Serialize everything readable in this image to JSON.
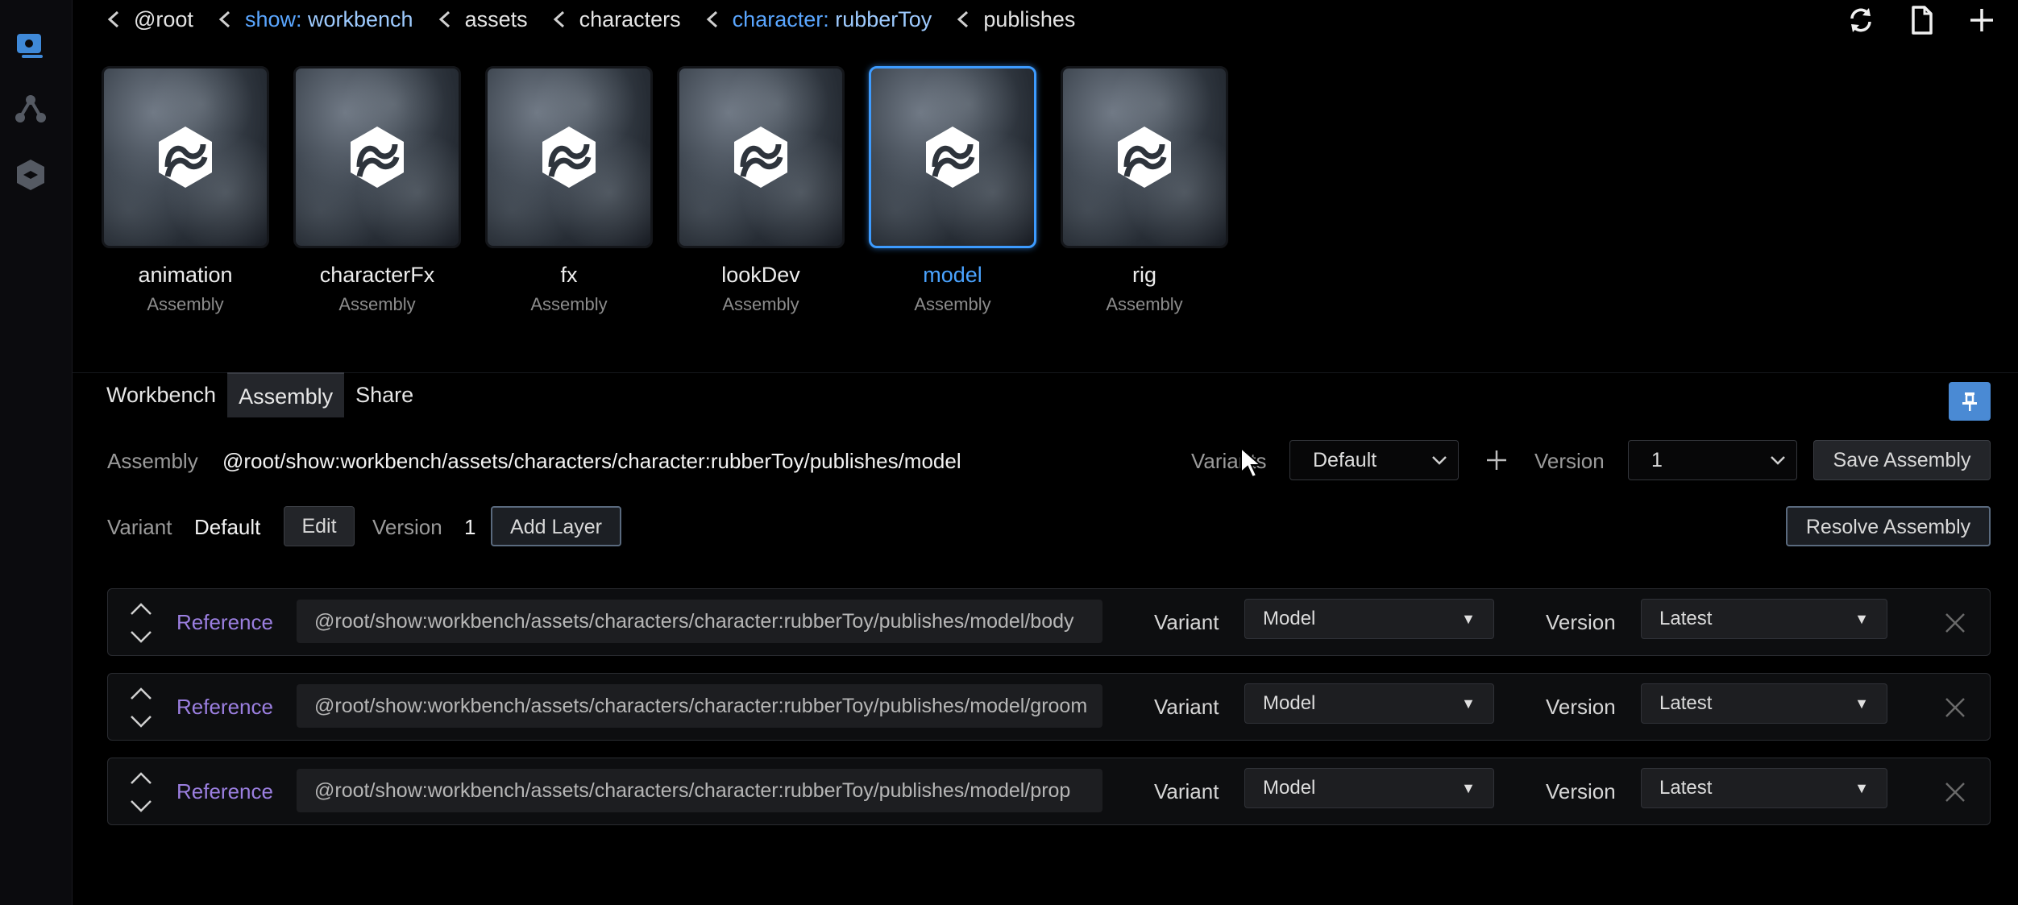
{
  "breadcrumbs": [
    {
      "key": "",
      "value": "@root"
    },
    {
      "key": "show:",
      "value": " workbench"
    },
    {
      "key": "",
      "value": "assets"
    },
    {
      "key": "",
      "value": "characters"
    },
    {
      "key": "character:",
      "value": " rubberToy"
    },
    {
      "key": "",
      "value": "publishes"
    }
  ],
  "top_actions": [
    "refresh-icon",
    "file-icon",
    "plus-icon"
  ],
  "sidebar_icons": [
    "viewer-icon",
    "graph-icon",
    "cube-icon"
  ],
  "cards": [
    {
      "title": "animation",
      "subtitle": "Assembly"
    },
    {
      "title": "characterFx",
      "subtitle": "Assembly"
    },
    {
      "title": "fx",
      "subtitle": "Assembly"
    },
    {
      "title": "lookDev",
      "subtitle": "Assembly"
    },
    {
      "title": "model",
      "subtitle": "Assembly",
      "selected": true
    },
    {
      "title": "rig",
      "subtitle": "Assembly"
    }
  ],
  "tabs": [
    {
      "label": "Workbench"
    },
    {
      "label": "Assembly",
      "active": true
    },
    {
      "label": "Share"
    }
  ],
  "assembly": {
    "label": "Assembly",
    "path": "@root/show:workbench/assets/characters/character:rubberToy/publishes/model",
    "variants_label": "Variants",
    "variants_value": "Default",
    "version_label": "Version",
    "version_value": "1",
    "save_label": "Save Assembly"
  },
  "variant_row": {
    "variant_label": "Variant",
    "variant_value": "Default",
    "edit_label": "Edit",
    "version_label": "Version",
    "version_value": "1",
    "add_layer_label": "Add Layer",
    "resolve_label": "Resolve Assembly"
  },
  "layers": [
    {
      "type": "Reference",
      "path": "@root/show:workbench/assets/characters/character:rubberToy/publishes/model/body",
      "variant_label": "Variant",
      "variant": "Model",
      "version_label": "Version",
      "version": "Latest"
    },
    {
      "type": "Reference",
      "path": "@root/show:workbench/assets/characters/character:rubberToy/publishes/model/groom",
      "variant_label": "Variant",
      "variant": "Model",
      "version_label": "Version",
      "version": "Latest"
    },
    {
      "type": "Reference",
      "path": "@root/show:workbench/assets/characters/character:rubberToy/publishes/model/prop",
      "variant_label": "Variant",
      "variant": "Model",
      "version_label": "Version",
      "version": "Latest"
    }
  ],
  "colors": {
    "accent": "#3d9bff",
    "reference": "#9b7fe0",
    "pin": "#4a8ad4"
  }
}
